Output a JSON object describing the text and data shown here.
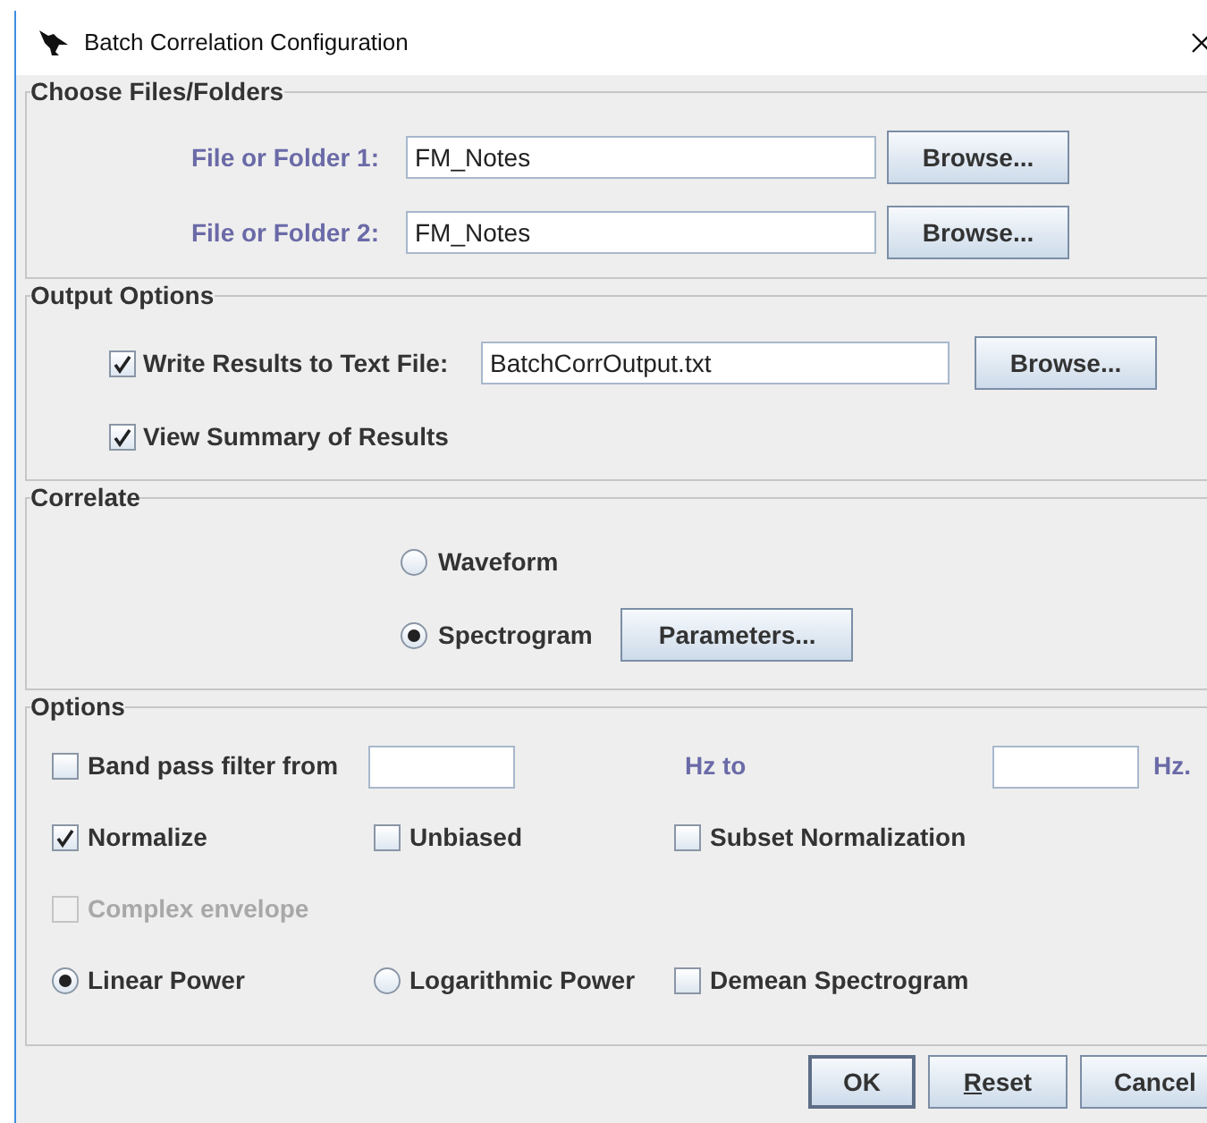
{
  "window": {
    "title": "Batch Correlation Configuration"
  },
  "file_group": {
    "title": "Choose Files/Folders",
    "rows": [
      {
        "label": "File or Folder 1:",
        "value": "FM_Notes",
        "button": "Browse..."
      },
      {
        "label": "File or Folder 2:",
        "value": "FM_Notes",
        "button": "Browse..."
      }
    ]
  },
  "output_group": {
    "title": "Output Options",
    "write_results": {
      "label": "Write Results to Text File:",
      "checked": true,
      "value": "BatchCorrOutput.txt",
      "button": "Browse..."
    },
    "view_summary": {
      "label": "View Summary of Results",
      "checked": true
    }
  },
  "correlate_group": {
    "title": "Correlate",
    "options": [
      {
        "label": "Waveform",
        "selected": false
      },
      {
        "label": "Spectrogram",
        "selected": true
      }
    ],
    "parameters_button": "Parameters..."
  },
  "options_group": {
    "title": "Options",
    "band_pass": {
      "label": "Band pass filter from",
      "checked": false,
      "hz_to": "Hz to",
      "hz_unit": "Hz."
    },
    "rows": [
      [
        {
          "kind": "checkbox",
          "label": "Normalize",
          "checked": true,
          "disabled": false
        },
        {
          "kind": "checkbox",
          "label": "Unbiased",
          "checked": false,
          "disabled": false
        },
        {
          "kind": "checkbox",
          "label": "Subset Normalization",
          "checked": false,
          "disabled": false
        }
      ],
      [
        {
          "kind": "checkbox",
          "label": "Complex envelope",
          "checked": false,
          "disabled": true
        }
      ],
      [
        {
          "kind": "radio",
          "label": "Linear Power",
          "selected": true,
          "disabled": false
        },
        {
          "kind": "radio",
          "label": "Logarithmic Power",
          "selected": false,
          "disabled": false
        },
        {
          "kind": "checkbox",
          "label": "Demean Spectrogram",
          "checked": false,
          "disabled": false
        }
      ]
    ]
  },
  "buttons": [
    {
      "label": "OK",
      "default": true
    },
    {
      "mnemonic": "R",
      "label": "eset",
      "default": false
    },
    {
      "label": "Cancel",
      "default": false
    }
  ]
}
